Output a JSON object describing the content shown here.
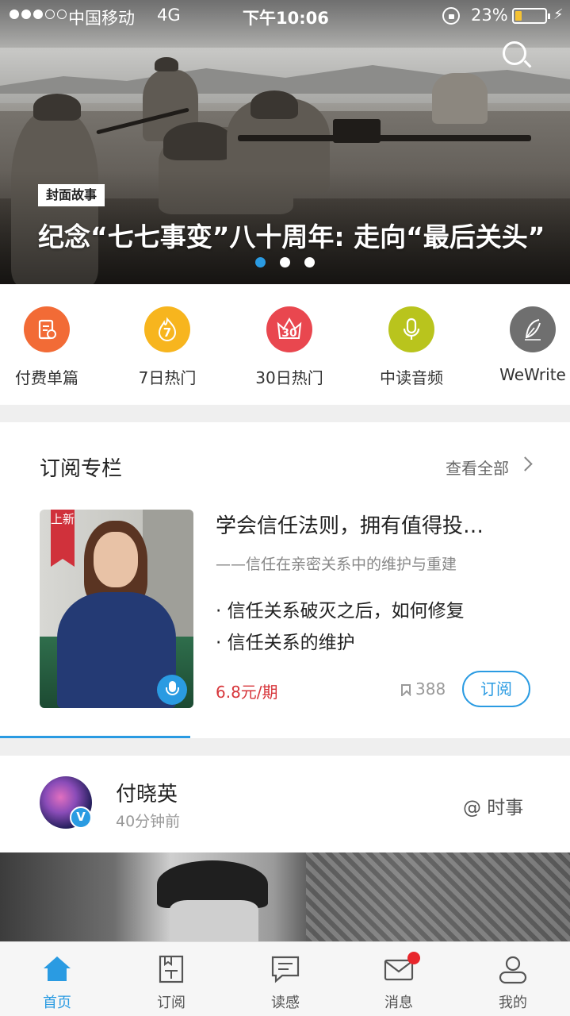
{
  "status_bar": {
    "carrier": "中国移动",
    "network": "4G",
    "time": "下午10:06",
    "battery_percent": "23%",
    "battery_level": 0.23
  },
  "hero": {
    "tag": "封面故事",
    "title": "纪念“七七事变”八十周年: 走向“最后关头”",
    "slide_count": 3,
    "active_slide": 0
  },
  "quick_nav": [
    {
      "label": "付费单篇",
      "icon": "paid-article-icon",
      "color": "#f26b36"
    },
    {
      "label": "7日热门",
      "icon": "fire-7-icon",
      "icon_text": "7",
      "color": "#f7b51e"
    },
    {
      "label": "30日热门",
      "icon": "crown-30-icon",
      "icon_text": "30",
      "color": "#e9474f"
    },
    {
      "label": "中读音频",
      "icon": "microphone-icon",
      "color": "#b9c41d"
    },
    {
      "label": "WeWrite",
      "icon": "feather-pen-icon",
      "color": "#6f6f6f"
    }
  ],
  "subscription": {
    "section_title": "订阅专栏",
    "view_all": "查看全部",
    "ribbon": "上新",
    "title": "学会信任法则，拥有值得投…",
    "subtitle": "——信任在亲密关系中的维护与重建",
    "points": [
      "· 信任关系破灭之后，如何修复",
      "· 信任关系的维护"
    ],
    "price": "6.8元/期",
    "bookmark_count": "388",
    "subscribe_label": "订阅"
  },
  "post": {
    "author": "付晓英",
    "verified_badge": "V",
    "time": "40分钟前",
    "topic": "@ 时事"
  },
  "tabbar": [
    {
      "label": "首页",
      "icon": "home-icon",
      "active": true
    },
    {
      "label": "订阅",
      "icon": "subscribe-book-icon",
      "active": false
    },
    {
      "label": "读感",
      "icon": "comment-icon",
      "active": false
    },
    {
      "label": "消息",
      "icon": "mail-icon",
      "active": false,
      "has_badge": true
    },
    {
      "label": "我的",
      "icon": "profile-icon",
      "active": false
    }
  ],
  "colors": {
    "accent": "#2a9be2",
    "price": "#d7363b",
    "badge": "#e8262c"
  }
}
